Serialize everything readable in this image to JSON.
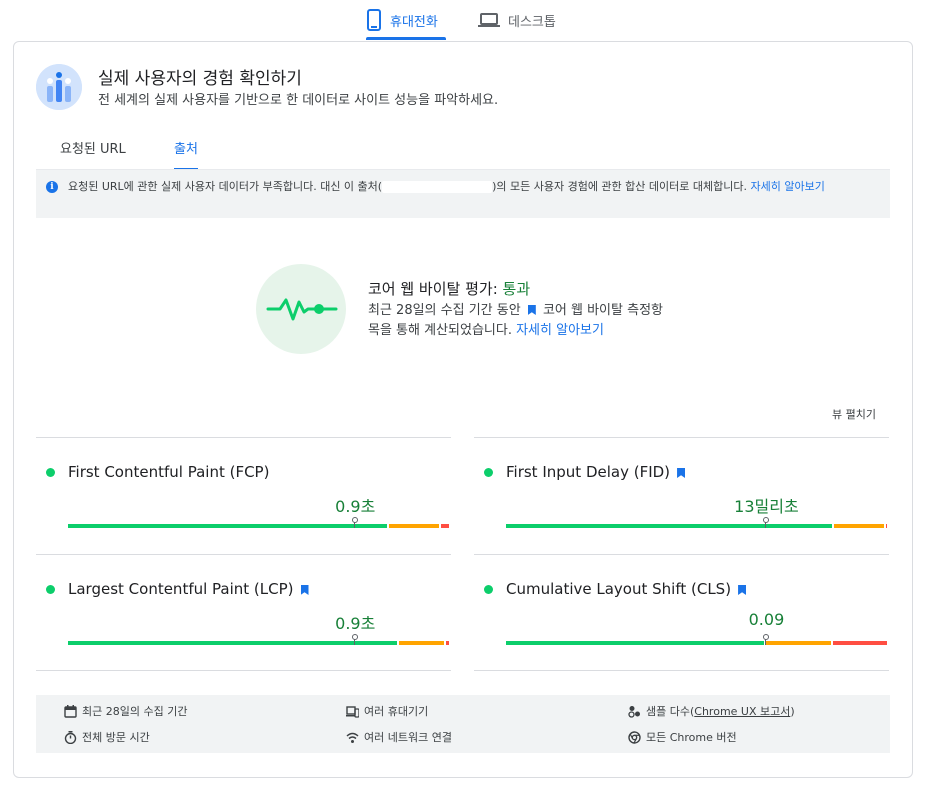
{
  "device_tabs": {
    "mobile_label": "휴대전화",
    "desktop_label": "데스크톱"
  },
  "header": {
    "title": "실제 사용자의 경험 확인하기",
    "subtitle": "전 세계의 실제 사용자를 기반으로 한 데이터로 사이트 성능을 파악하세요."
  },
  "url_tabs": {
    "requested_label": "요청된 URL",
    "origin_label": "출처"
  },
  "info": {
    "text_before": "요청된 URL에 관한 실제 사용자 데이터가 부족합니다. 대신 이 출처(",
    "text_after": ")의 모든 사용자 경험에 관한 합산 데이터로 대체합니다. ",
    "link": "자세히 알아보기"
  },
  "cwv": {
    "title_prefix": "코어 웹 바이탈 평가: ",
    "status": "통과",
    "desc_part1": "최근 28일의 수집 기간 동안",
    "desc_part2": "코어 웹 바이탈 측정항목을 통해 계산되었습니다. ",
    "link": "자세히 알아보기"
  },
  "expand_view": "뷰 펼치기",
  "metrics": [
    {
      "name": "First Contentful Paint (FCP)",
      "value": "0.9초",
      "core": false,
      "good": 0.837,
      "ni": 0.137,
      "poor": 0.026,
      "marker": 0.75
    },
    {
      "name": "First Input Delay (FID)",
      "value": "13밀리초",
      "core": true,
      "good": 0.856,
      "ni": 0.137,
      "poor": 0.007,
      "marker": 0.68
    },
    {
      "name": "Largest Contentful Paint (LCP)",
      "value": "0.9초",
      "core": true,
      "good": 0.864,
      "ni": 0.122,
      "poor": 0.014,
      "marker": 0.75
    },
    {
      "name": "Cumulative Layout Shift (CLS)",
      "value": "0.09",
      "core": true,
      "good": 0.678,
      "ni": 0.176,
      "poor": 0.146,
      "marker": 0.68
    }
  ],
  "footer": {
    "period": "최근 28일의 수집 기간",
    "visit": "전체 방문 시간",
    "devices": "여러 휴대기기",
    "networks": "여러 네트워크 연결",
    "samples_prefix": "샘플 다수(",
    "samples_link": "Chrome UX 보고서",
    "samples_suffix": ")",
    "chrome": "모든 Chrome 버전"
  },
  "colors": {
    "accent": "#1a73e8",
    "good": "#0cce6b",
    "needs_improvement": "#ffa400",
    "poor": "#ff4e42",
    "pass_text": "#188038"
  }
}
